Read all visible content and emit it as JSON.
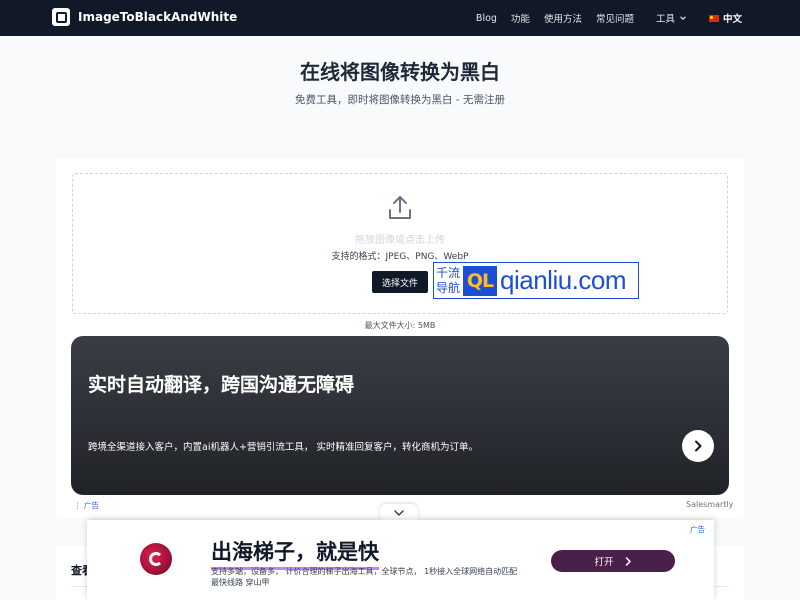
{
  "nav": {
    "brand": "ImageToBlackAndWhite",
    "links": [
      "Blog",
      "功能",
      "使用方法",
      "常见问题"
    ],
    "tools_label": "工具",
    "lang_label": "中文"
  },
  "hero": {
    "title": "在线将图像转换为黑白",
    "subtitle": "免费工具，即时将图像转换为黑白 - 无需注册"
  },
  "upload": {
    "drop_hint": "拖放图像或点击上传",
    "formats": "支持的格式：JPEG、PNG、WebP",
    "choose_button": "选择文件",
    "max_size": "最大文件大小: 5MB"
  },
  "watermark": {
    "cn_line1": "千流",
    "cn_line2": "导航",
    "mark": "QL",
    "url": "qianliu.com"
  },
  "ad_banner": {
    "title": "实时自动翻译，跨国沟通无障碍",
    "description": "跨境全渠道接入客户，内置ai机器人+营销引流工具， 实时精准回复客户，转化商机为订单。",
    "ad_label": "广告",
    "brand": "Salesmartly"
  },
  "section": {
    "title": "查看"
  },
  "bottom_ad": {
    "title": "出海梯子，就是快",
    "desc_line1": "支持多端，设备多， 计价合理的梯子出海工具，全球节点， 1秒接入全球网络自动匹配",
    "desc_line2": "最快线路 穿山甲",
    "open_button": "打开",
    "ad_label": "广告"
  },
  "icons": {
    "upload": "upload-icon",
    "arrow": "arrow-right-icon",
    "collapse": "chevron-down-icon"
  },
  "colors": {
    "nav_bg": "#111827",
    "accent": "#111827",
    "ad_label": "#2563eb",
    "ad_button": "#4a1f4a"
  }
}
